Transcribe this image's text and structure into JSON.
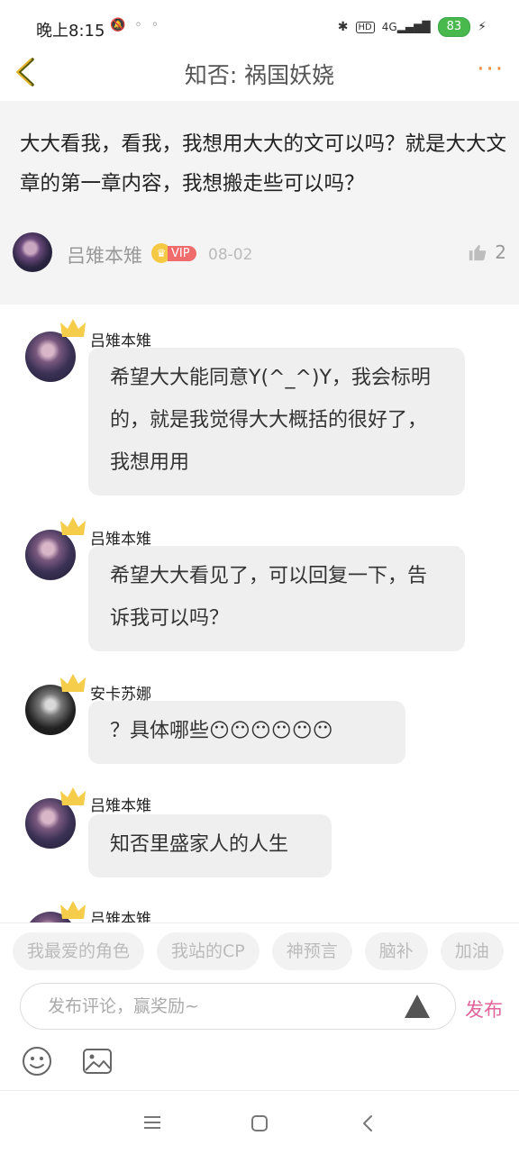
{
  "status_bar": {
    "time": "晚上8:15",
    "battery": "83",
    "network": "4G",
    "hd_label": "HD"
  },
  "header": {
    "title": "知否: 祸国妖娆",
    "more_label": "···"
  },
  "post": {
    "text": "大大看我，看我，我想用大大的文可以吗？就是大大文章的第一章内容，我想搬走些可以吗？",
    "author": "吕雉本雉",
    "vip_label": "VIP",
    "date": "08-02",
    "likes": "2"
  },
  "comments": [
    {
      "name": "吕雉本雉",
      "text": "希望大大能同意Y(^_^)Y，我会标明的，就是我觉得大大概括的很好了，我想用用"
    },
    {
      "name": "吕雉本雉",
      "text": "希望大大看见了，可以回复一下，告诉我可以吗？"
    },
    {
      "name": "安卡苏娜",
      "text": "？具体哪些😶😶😶😶😶😶"
    },
    {
      "name": "吕雉本雉",
      "text": "知否里盛家人的人生"
    },
    {
      "name": "吕雉本雉",
      "text": ""
    }
  ],
  "tags": [
    "我最爱的角色",
    "我站的CP",
    "神预言",
    "脑补",
    "加油"
  ],
  "composer": {
    "placeholder": "发布评论，赢奖励~",
    "publish_label": "发布"
  },
  "colors": {
    "accent_pink": "#e0649a",
    "more_orange": "#f08a3e",
    "vip_red": "#f06b6b",
    "battery_green": "#49b84d"
  }
}
